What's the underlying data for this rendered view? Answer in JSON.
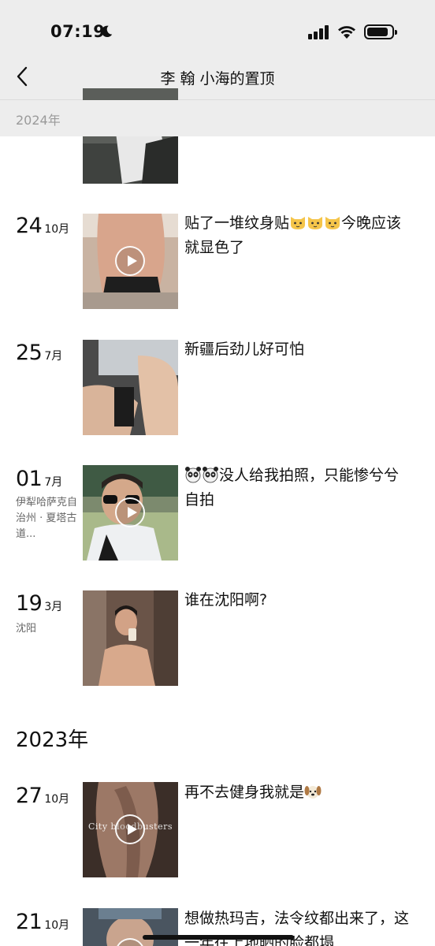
{
  "status_bar": {
    "time": "07:19"
  },
  "nav": {
    "title": "李  翰 小海的置顶"
  },
  "sticky_year": "2024年",
  "posts": [
    {
      "day": "",
      "month": "",
      "location": "",
      "text": "",
      "has_video": false
    },
    {
      "day": "24",
      "month": "10月",
      "location": "",
      "text": "贴了一堆纹身贴",
      "text_after": "今晚应该就显色了",
      "emojis": [
        "cat-face",
        "cat-face",
        "cat-face"
      ],
      "has_video": true
    },
    {
      "day": "25",
      "month": "7月",
      "location": "",
      "text": "新疆后劲儿好可怕",
      "has_video": false
    },
    {
      "day": "01",
      "month": "7月",
      "location": "伊犁哈萨克自治州 · 夏塔古道...",
      "text": "没人给我拍照，只能惨兮兮自拍",
      "emojis": [
        "panda-face",
        "panda-face"
      ],
      "has_video": true
    },
    {
      "day": "19",
      "month": "3月",
      "location": "沈阳",
      "text": "谁在沈阳啊?",
      "has_video": false
    },
    {
      "day": "27",
      "month": "10月",
      "location": "",
      "text": "再不去健身我就是",
      "emojis": [
        "dog-face"
      ],
      "has_video": true,
      "watermark": "City bloodbusters"
    },
    {
      "day": "21",
      "month": "10月",
      "location": "",
      "text": "想做热玛吉，法令纹都出来了，这一年往上地晒的脸都塌",
      "has_video": true
    }
  ],
  "year_2023": "2023年",
  "colors": {
    "bar_bg": "#ededed",
    "secondary_text": "#9a9a9a",
    "location_text": "#666666"
  }
}
